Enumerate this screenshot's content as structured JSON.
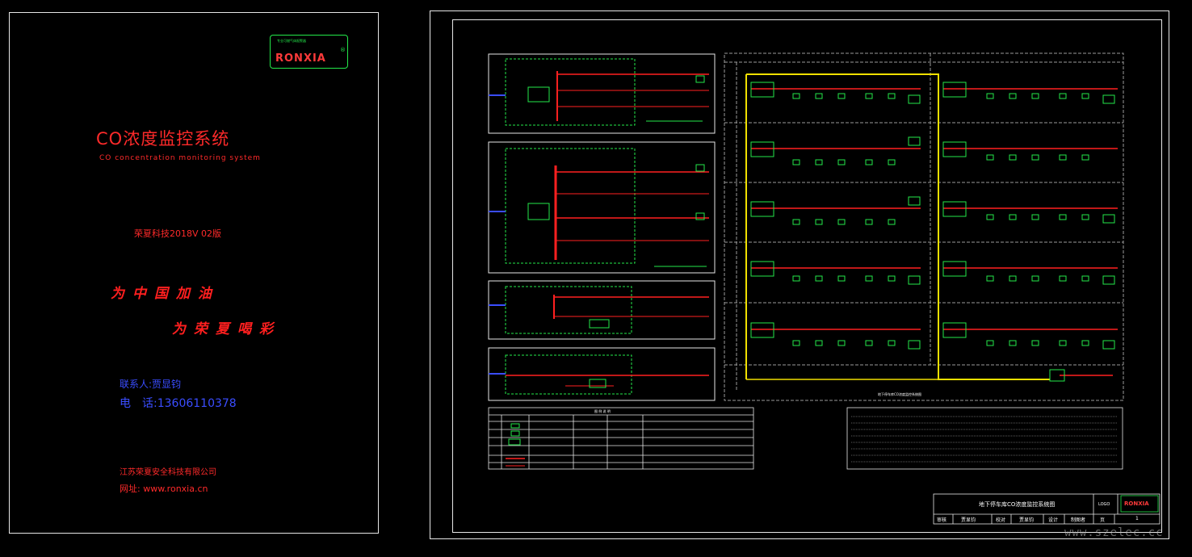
{
  "cover": {
    "logo": {
      "top_text": "专业可燃气体报警器",
      "brand": "RONXIA",
      "reg": "®"
    },
    "title": "CO浓度监控系统",
    "subtitle": "CO concentration monitoring system",
    "version": "荣夏科技2018V 02版",
    "slogan_1": "为中国加油",
    "slogan_2": "为荣夏喝彩",
    "contact_name": "联系人:贾显钧",
    "contact_phone": "电　话:13606110378",
    "company": "江苏荣夏安全科技有限公司",
    "website": "网址: www.ronxia.cn"
  },
  "drawing": {
    "title_block": {
      "drawing_title": "地下停车库CO浓度监控系统图",
      "logo_label": "LOGO",
      "brand": "RONXIA",
      "row": [
        "审核",
        "贾显钧",
        "校对",
        "贾显钧",
        "设计",
        "制图者",
        "页",
        "1"
      ]
    },
    "legend": {
      "title": "图 例 说 明"
    },
    "bus_label": "地下停车库CO浓度监控系统图"
  },
  "watermark": "www.szelec.cc"
}
